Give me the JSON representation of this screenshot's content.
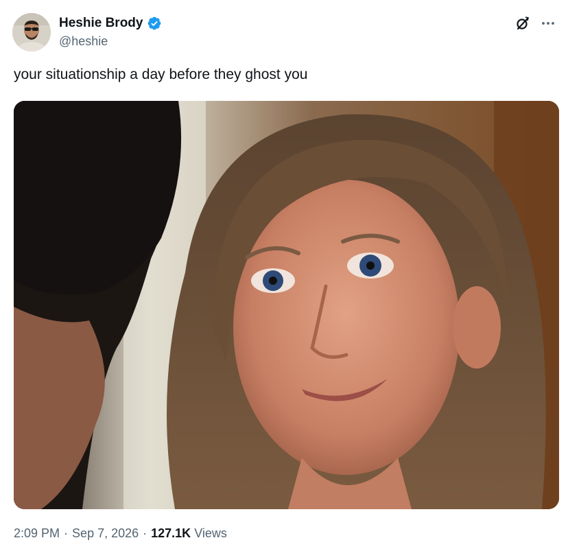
{
  "author": {
    "display_name": "Heshie Brody",
    "handle": "@heshie",
    "verified": true,
    "avatar_icon": "profile-photo-sunglasses"
  },
  "tweet": {
    "text": "your situationship a day before they ghost you",
    "media_icon": "movie-still-photo"
  },
  "meta": {
    "time": "2:09 PM",
    "separator": "·",
    "date": "Sep 7, 2026",
    "views_count": "127.1K",
    "views_label": "Views"
  },
  "actions": {
    "grok_icon": "grok-icon",
    "more_icon": "more-icon"
  },
  "colors": {
    "verified_blue": "#1d9bf0",
    "secondary_text": "#536471",
    "primary_text": "#0f1419"
  }
}
